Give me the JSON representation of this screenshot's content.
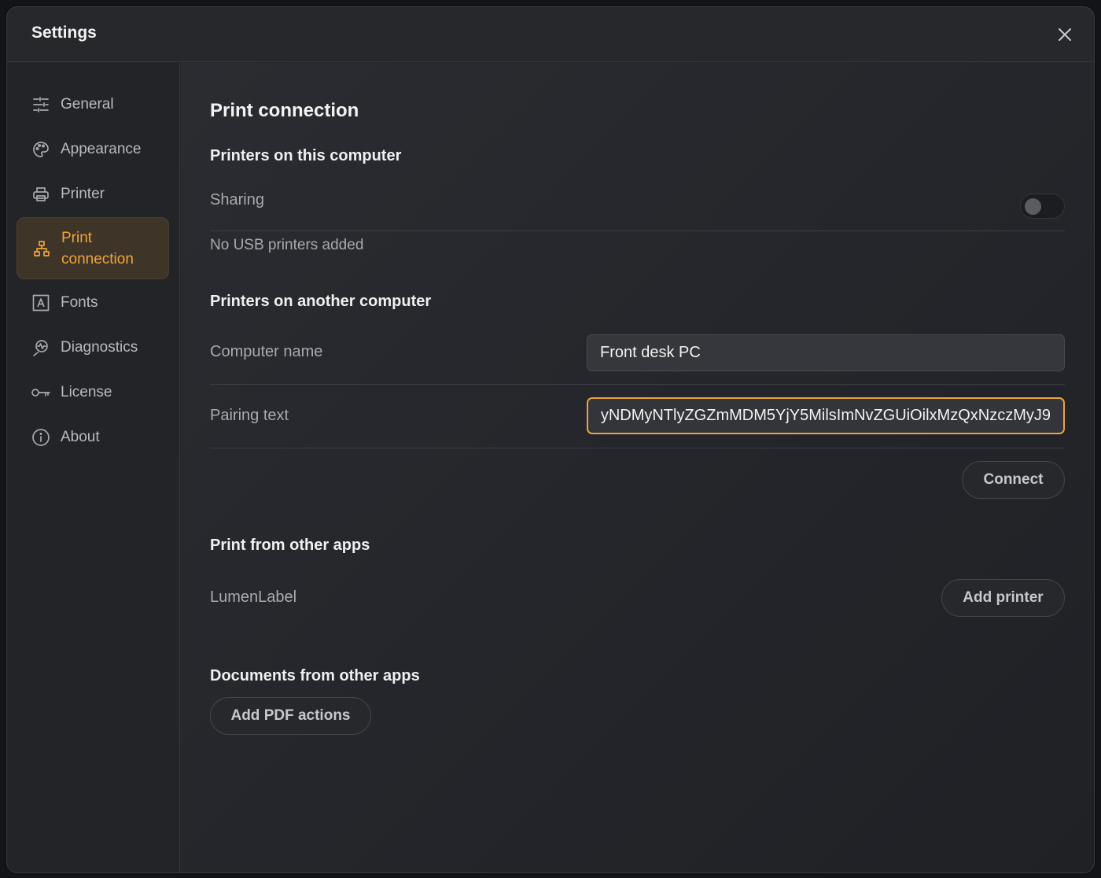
{
  "dialog": {
    "title": "Settings"
  },
  "sidebar": {
    "items": [
      {
        "label": "General",
        "icon": "sliders-icon"
      },
      {
        "label": "Appearance",
        "icon": "palette-icon"
      },
      {
        "label": "Printer",
        "icon": "printer-icon"
      },
      {
        "label": "Print connection",
        "icon": "network-icon",
        "active": true
      },
      {
        "label": "Fonts",
        "icon": "font-icon"
      },
      {
        "label": "Diagnostics",
        "icon": "diagnostics-icon"
      },
      {
        "label": "License",
        "icon": "key-icon"
      },
      {
        "label": "About",
        "icon": "info-icon"
      }
    ]
  },
  "main": {
    "heading": "Print connection",
    "local": {
      "heading": "Printers on this computer",
      "sharing_label": "Sharing",
      "sharing_on": false,
      "empty_text": "No USB printers added"
    },
    "remote": {
      "heading": "Printers on another computer",
      "computer_name_label": "Computer name",
      "computer_name_value": "Front desk PC",
      "pairing_label": "Pairing text",
      "pairing_value": "yNDMyNTlyZGZmMDM5YjY5MilsImNvZGUiOilxMzQxNzczMyJ9",
      "connect_label": "Connect"
    },
    "other_apps": {
      "heading": "Print from other apps",
      "app_name": "LumenLabel",
      "add_printer_label": "Add printer"
    },
    "documents": {
      "heading": "Documents from other apps",
      "add_pdf_label": "Add PDF actions"
    }
  },
  "colors": {
    "accent": "#f0a43a",
    "background": "#25272b"
  }
}
